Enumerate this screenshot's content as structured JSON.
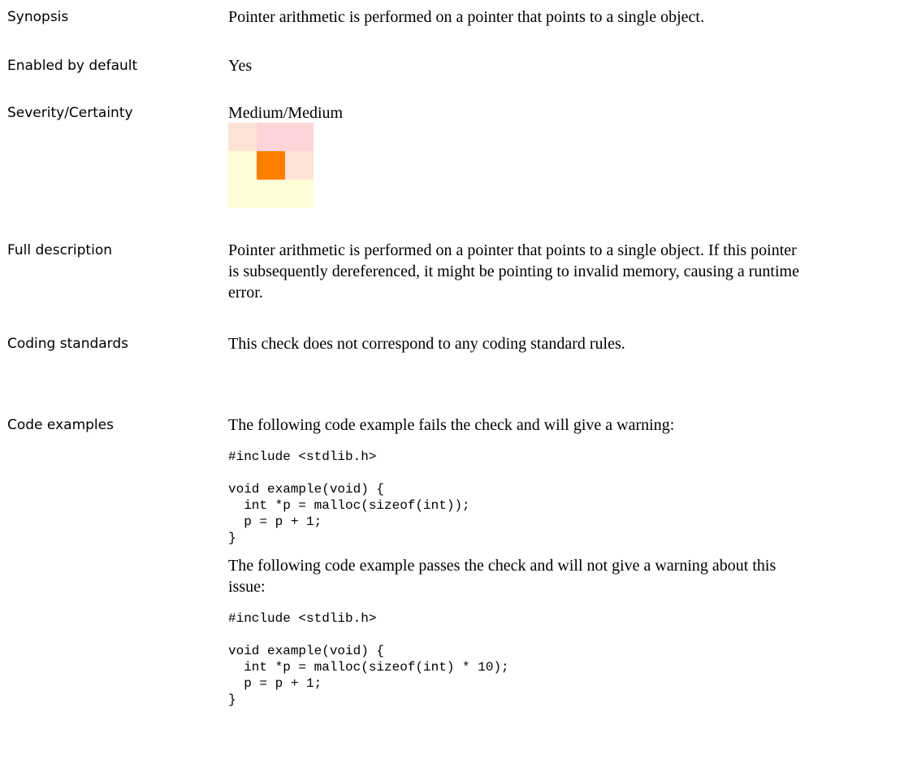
{
  "synopsis": {
    "label": "Synopsis",
    "text": "Pointer arithmetic is performed on a pointer that points to a single object."
  },
  "enabled": {
    "label": "Enabled by default",
    "text": "Yes"
  },
  "severity": {
    "label": "Severity/Certainty",
    "text": "Medium/Medium",
    "matrix_colors": [
      [
        "#fde3d6",
        "#fdd5d8",
        "#fdd5d8"
      ],
      [
        "#fffdd6",
        "#ff7f00",
        "#fde3d6"
      ],
      [
        "#fffdd6",
        "#fffdd6",
        "#fffdd6"
      ]
    ]
  },
  "full_description": {
    "label": "Full description",
    "lines": [
      "Pointer arithmetic is performed on a pointer that points to a single object. If this pointer",
      "is subsequently dereferenced, it might be pointing to invalid memory, causing a runtime",
      "error."
    ]
  },
  "coding_standards": {
    "label": "Coding standards",
    "text": "This check does not correspond to any coding standard rules."
  },
  "code_examples": {
    "label": "Code examples",
    "fail_intro": "The following code example fails the check and will give a warning:",
    "fail_code": "#include <stdlib.h>\n\nvoid example(void) {\n  int *p = malloc(sizeof(int));\n  p = p + 1;\n}",
    "pass_intro_lines": [
      "The following code example passes the check and will not give a warning about this",
      "issue:"
    ],
    "pass_code": "#include <stdlib.h>\n\nvoid example(void) {\n  int *p = malloc(sizeof(int) * 10);\n  p = p + 1;\n}"
  }
}
